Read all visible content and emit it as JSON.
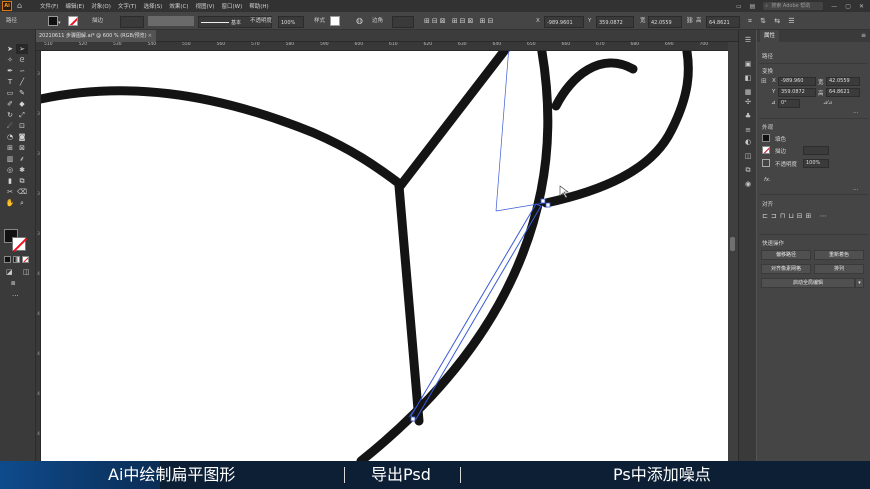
{
  "menubar": {
    "app_logo": "Ai",
    "items": [
      "文件(F)",
      "编辑(E)",
      "对象(O)",
      "文字(T)",
      "选择(S)",
      "效果(C)",
      "视图(V)",
      "窗口(W)",
      "帮助(H)"
    ],
    "search_placeholder": "搜索 Adobe 帮助"
  },
  "control_bar": {
    "object_label": "路径",
    "stroke_label": "描边",
    "brush_label": "基本",
    "opacity_label": "不透明度",
    "opacity_value": "100%",
    "style_label": "样式",
    "corner_label": "边角",
    "x_label": "X",
    "x_value": "-989.9601",
    "y_label": "Y",
    "y_value": "359.0872",
    "w_label": "宽",
    "w_value": "42.0559",
    "h_label": "高",
    "h_value": "64.8621"
  },
  "document_tab": {
    "title": "20210611 步骤图解.ai* @ 600 % (RGB/预览)",
    "close": "×"
  },
  "ruler": {
    "h_labels": [
      "510",
      "520",
      "530",
      "540",
      "550",
      "560",
      "570",
      "580",
      "590",
      "600",
      "610",
      "620",
      "630",
      "640",
      "650",
      "660",
      "670",
      "680",
      "690",
      "700"
    ],
    "v_labels": [
      "3",
      "3",
      "3",
      "3",
      "3",
      "4",
      "4",
      "4",
      "4",
      "4"
    ]
  },
  "right_panel": {
    "tab_label": "属性",
    "section_path": "路径",
    "section_transform": "变换",
    "x_label": "X",
    "x_value": "-989.960",
    "y_label": "Y",
    "y_value": "359.0872",
    "w_label": "宽",
    "w_value": "42.0559",
    "h_label": "高",
    "h_value": "64.8621",
    "angle_value": "0°",
    "section_appearance": "外观",
    "fill_label": "填色",
    "stroke_label": "描边",
    "opacity_label": "不透明度",
    "opacity_value": "100%",
    "fx_label": "fx.",
    "section_align": "对齐",
    "section_quick": "快速操作",
    "btn_offset": "偏移路径",
    "btn_recolor": "重新着色",
    "btn_pixel": "对齐像素网格",
    "btn_arrange": "排列",
    "btn_global": "启动全局编辑"
  },
  "subtitle": {
    "step1": "Ai中绘制扁平图形",
    "step2": "导出Psd",
    "step3": "Ps中添加噪点"
  },
  "colors": {
    "chrome_dark": "#323232",
    "panel": "#454545",
    "stroke_art": "#141414",
    "selection": "#3a5bd6",
    "subtitle_bg": "#0c1f35"
  }
}
